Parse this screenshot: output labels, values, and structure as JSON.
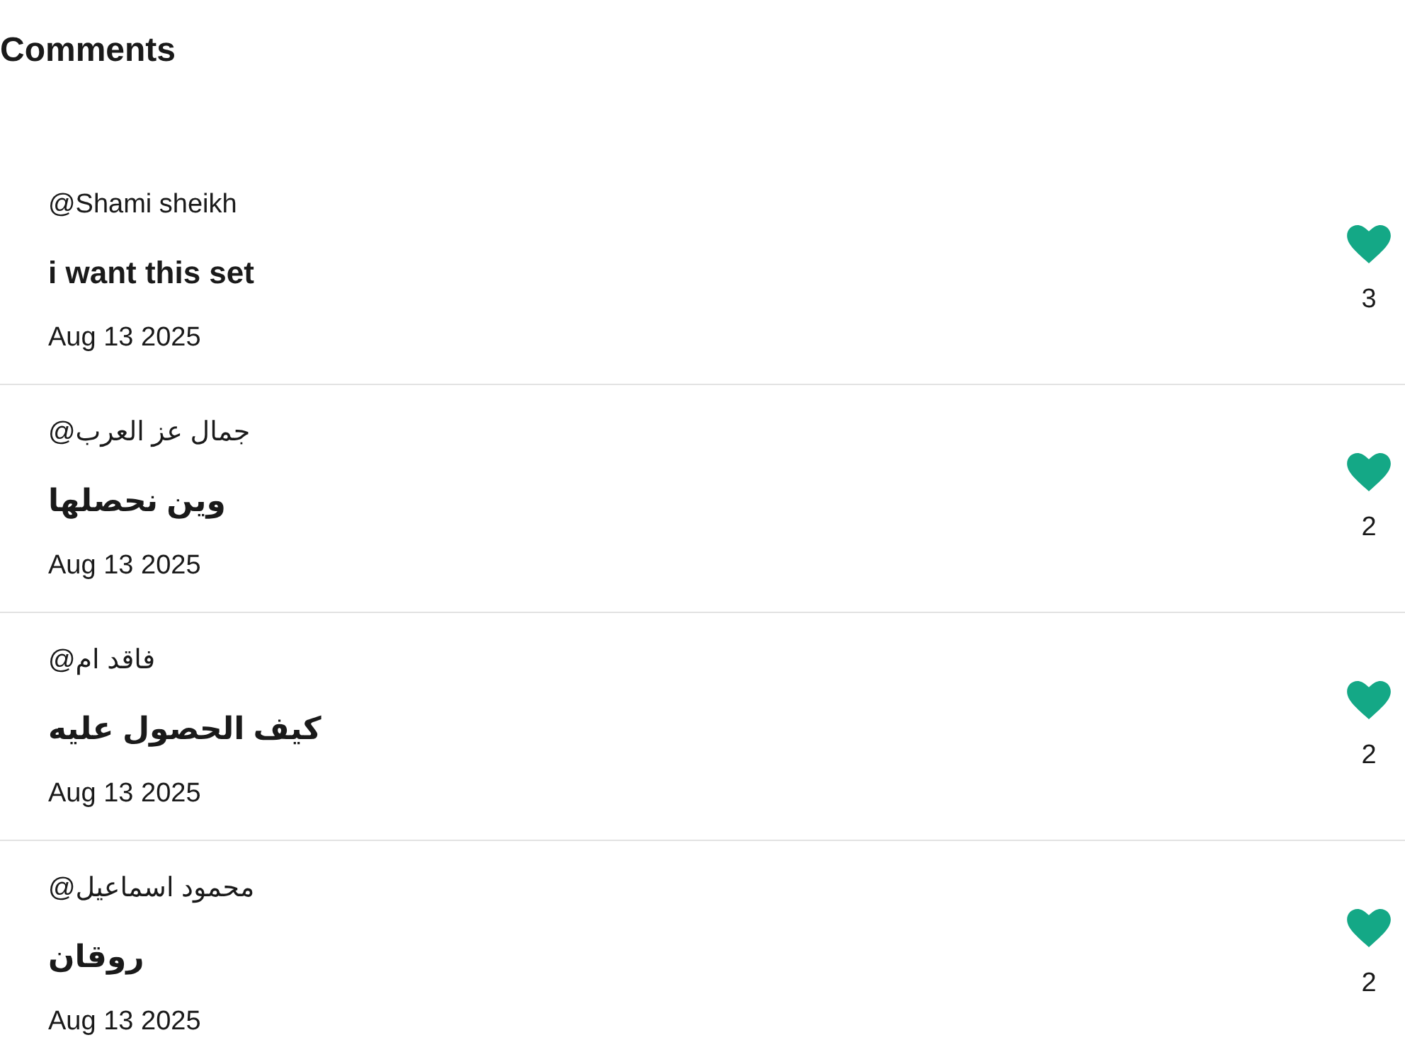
{
  "title": "Comments",
  "comments": [
    {
      "author": "@Shami sheikh",
      "text": "i want this set",
      "date": "Aug 13 2025",
      "liked": true,
      "likes": "3"
    },
    {
      "author": "@جمال عز العرب",
      "text": "وين نحصلها",
      "date": "Aug 13 2025",
      "liked": true,
      "likes": "2"
    },
    {
      "author": "@فاقد ام",
      "text": "كيف الحصول عليه",
      "date": "Aug 13 2025",
      "liked": true,
      "likes": "2"
    },
    {
      "author": "@محمود اسماعيل",
      "text": "روقان",
      "date": "Aug 13 2025",
      "liked": true,
      "likes": "2"
    }
  ]
}
